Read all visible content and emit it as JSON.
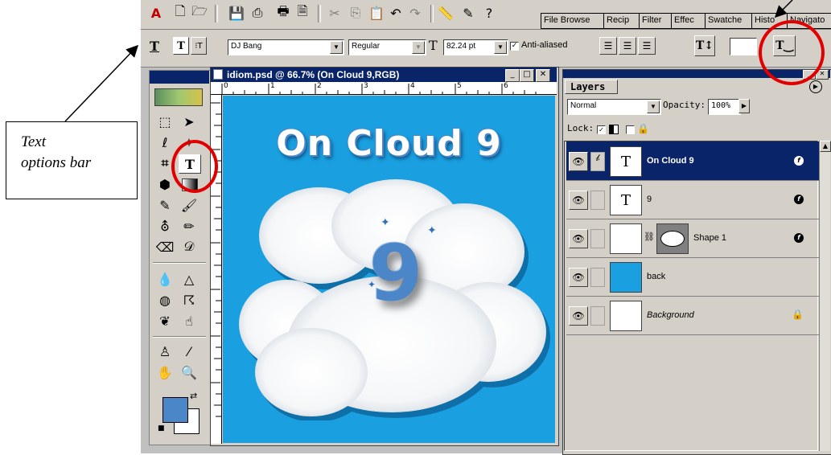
{
  "menubar": {
    "tabs": [
      "File Browse",
      "Recip",
      "Filter",
      "Effec",
      "Swatche",
      "Histo",
      "Navigato"
    ]
  },
  "options_bar": {
    "font_family": "DJ Bang",
    "font_style": "Regular",
    "font_size": "82.24 pt",
    "anti_aliased_label": "Anti-aliased",
    "anti_aliased_checked": true
  },
  "document": {
    "title": "idiom.psd @ 66.7% (On Cloud 9,RGB)",
    "canvas_text": "On Cloud 9",
    "cloud_text": "9",
    "ruler_ticks": [
      "0",
      "1",
      "2",
      "3",
      "4",
      "5",
      "6"
    ],
    "canvas_color": "#1aa0e0"
  },
  "layers_panel": {
    "title": "Layers",
    "blend_mode": "Normal",
    "opacity_label": "Opacity:",
    "opacity_value": "100%",
    "lock_label": "Lock:",
    "layers": [
      {
        "name": "On Cloud 9",
        "thumb": "T",
        "selected": true,
        "fx": true
      },
      {
        "name": "9",
        "thumb": "T",
        "selected": false,
        "fx": true
      },
      {
        "name": "Shape 1",
        "thumb": "shape",
        "selected": false,
        "fx": true
      },
      {
        "name": "back",
        "thumb": "blue",
        "selected": false,
        "fx": false
      },
      {
        "name": "Background",
        "thumb": "white",
        "selected": false,
        "fx": false,
        "locked": true
      }
    ]
  },
  "callout": {
    "line1": "Text",
    "line2": "options bar"
  },
  "colors": {
    "highlight_circle": "#e00000",
    "selection": "#0a246a"
  }
}
